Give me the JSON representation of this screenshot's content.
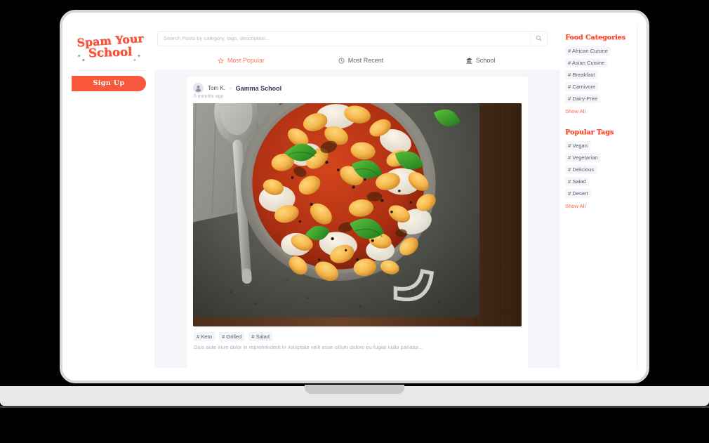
{
  "brand": {
    "logo_line1": "Spam Your",
    "logo_line2": "School",
    "accent": "#f9543a",
    "button_accent": "#f9583d",
    "feed_background": "#f5f6fa"
  },
  "left_rail": {
    "signup_label": "Sign Up"
  },
  "search": {
    "value": "",
    "placeholder": "Search Posts by category, tags, description...",
    "button_icon": "search-icon"
  },
  "tabs": [
    {
      "label": "Most Popular",
      "icon": "star-icon",
      "active": true
    },
    {
      "label": "Most Recent",
      "icon": "clock-icon",
      "active": false
    },
    {
      "label": "School",
      "icon": "building-icon",
      "active": false
    }
  ],
  "post": {
    "avatar_icon": "user-avatar-icon",
    "author": "Tom K.",
    "separator": "-",
    "school": "Gamma School",
    "timestamp": "5 months ago",
    "image_alt": "Gnocchi in tomato sauce with mozzarella and fresh basil in a metal pan on a slate board with a silver spoon",
    "tags": [
      "# Keto",
      "# Grilled",
      "# Salad"
    ],
    "description": "Duis aute irure dolor in reprehenderit in voluptate velit esse cillum dolore eu fugiat nulla pariatur..."
  },
  "sidebar": {
    "categories": {
      "title": "Food Categories",
      "items": [
        "# African Cuisine",
        "# Asian Cuisine",
        "# Breakfast",
        "# Carnivore",
        "# Dairy-Free"
      ],
      "show_all": "Show All"
    },
    "tags": {
      "title": "Popular Tags",
      "items": [
        "# Vegan",
        "# Vegetarian",
        "# Delicious",
        "# Salad",
        "# Desert"
      ],
      "show_all": "Show All"
    }
  }
}
